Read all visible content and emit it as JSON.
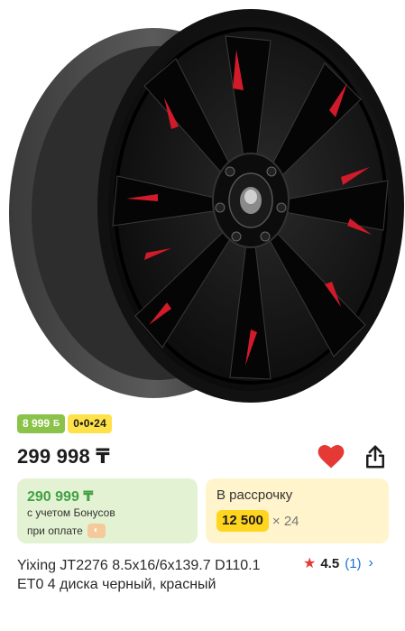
{
  "product": {
    "image_alt": "wheel-photo",
    "bonus_badge": {
      "amount": "8 999",
      "icon": "b-bonus-icon"
    },
    "installment_badge": "0•0•24",
    "price": "299 998 ₸",
    "favorite_icon": "heart-icon",
    "share_icon": "share-icon",
    "bonus_card": {
      "price": "290 999 ₸",
      "line1": "с учетом Бонусов",
      "line2": "при оплате",
      "coin_icon": "bonus-coin-icon"
    },
    "installment_card": {
      "title": "В рассрочку",
      "amount": "12 500",
      "multiplier": "× 24"
    },
    "title": "Yixing JT2276 8.5x16/6x139.7 D110.1 ET0 4 диска черный, красный",
    "rating": {
      "value": "4.5",
      "count": "(1)"
    }
  },
  "colors": {
    "bonus_green": "#8bc34a",
    "installment_yellow": "#ffe24a",
    "heart_red": "#e53935",
    "link_blue": "#1e6fd9",
    "bonus_card_bg": "#e3f2d2",
    "installment_card_bg": "#fff4cc"
  }
}
